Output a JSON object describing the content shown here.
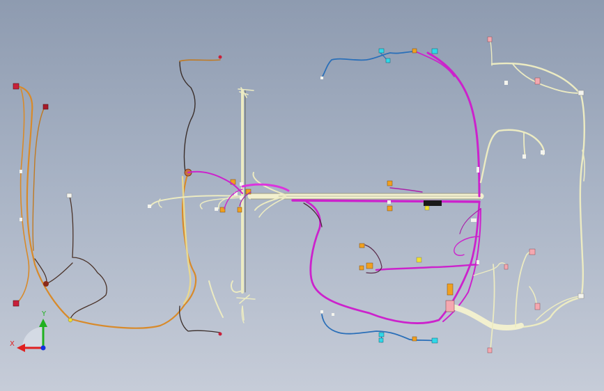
{
  "view": {
    "background_top": "#8e9bb0",
    "background_bottom": "#c6ccd8"
  },
  "triad": {
    "x_label": "X",
    "y_label": "Y",
    "x_color": "#e02020",
    "y_color": "#20b020",
    "z_color": "#1030e0"
  },
  "wire_colors": {
    "orange": "#d88a2a",
    "magenta": "#cc22cc",
    "cream": "#ecebc2",
    "dark": "#3a2e2a",
    "blue": "#2a6fb8"
  },
  "connector_colors": {
    "red": "#c8203a",
    "orange": "#f0a020",
    "pink": "#f4a8b0",
    "cyan": "#30d8e8",
    "yellow": "#f0e030",
    "white": "#f4f4ee"
  }
}
